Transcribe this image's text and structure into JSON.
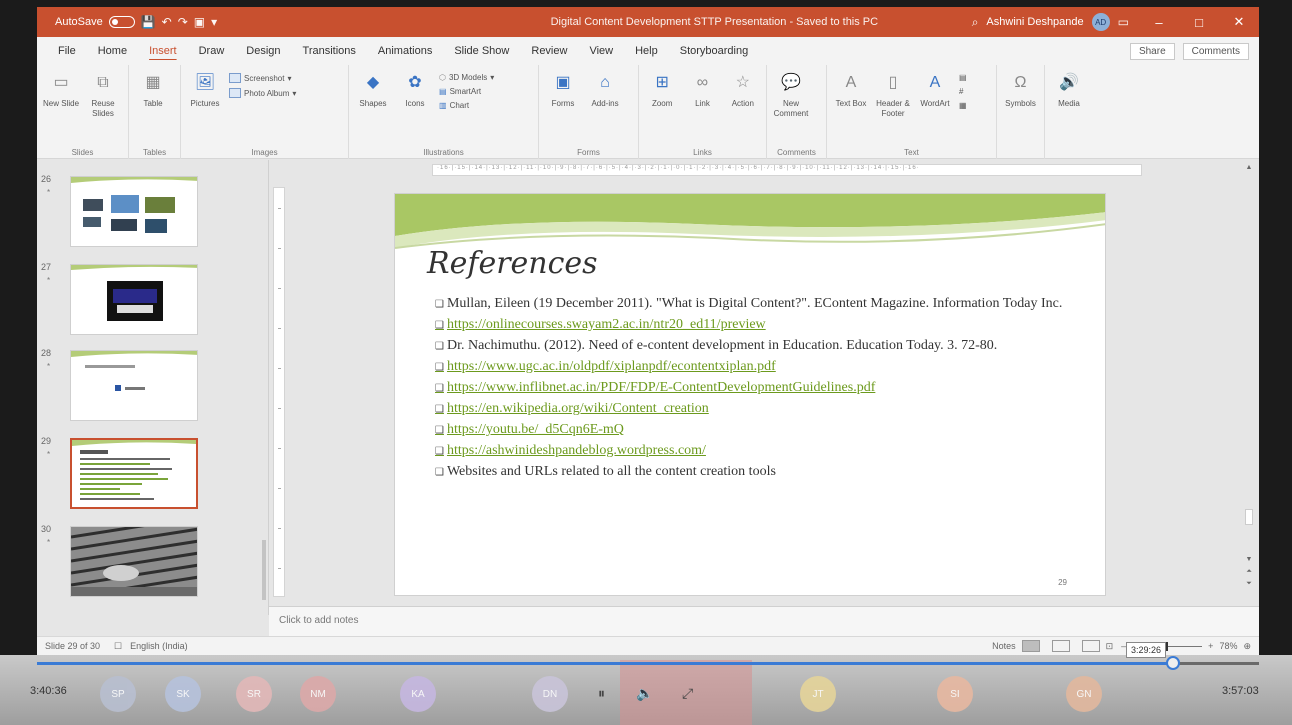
{
  "titlebar": {
    "autosave": "AutoSave",
    "autosave_state": "Off",
    "doc_title": "Digital Content Development STTP Presentation - Saved to this PC",
    "user_name": "Ashwini Deshpande",
    "user_initials": "AD",
    "minimize": "–",
    "maximize": "□",
    "close": "✕"
  },
  "tabs": [
    "File",
    "Home",
    "Insert",
    "Draw",
    "Design",
    "Transitions",
    "Animations",
    "Slide Show",
    "Review",
    "View",
    "Help",
    "Storyboarding"
  ],
  "active_tab": "Insert",
  "share_label": "Share",
  "comments_label": "Comments",
  "ribbon": {
    "slides": {
      "label": "Slides",
      "new_slide": "New Slide",
      "reuse": "Reuse Slides"
    },
    "tables": {
      "label": "Tables",
      "table": "Table"
    },
    "images": {
      "label": "Images",
      "pictures": "Pictures",
      "screenshot": "Screenshot",
      "photo_album": "Photo Album"
    },
    "illustrations": {
      "label": "Illustrations",
      "shapes": "Shapes",
      "icons": "Icons",
      "models": "3D Models",
      "smartart": "SmartArt",
      "chart": "Chart"
    },
    "forms": {
      "label": "Forms",
      "forms": "Forms"
    },
    "addins": {
      "addins": "Add-ins"
    },
    "links": {
      "label": "Links",
      "zoom": "Zoom",
      "link": "Link",
      "action": "Action"
    },
    "comments": {
      "label": "Comments",
      "new_comment": "New Comment"
    },
    "text": {
      "label": "Text",
      "textbox": "Text Box",
      "header_footer": "Header & Footer",
      "wordart": "WordArt"
    },
    "symbols": {
      "symbols": "Symbols"
    },
    "media": {
      "media": "Media"
    }
  },
  "ruler_text": "·16·|·15·|·14·|·13·|·12·|·11·|·10·|·9·|·8·|·7·|·6·|·5·|·4·|·3·|·2·|·1·|·0·|·1·|·2·|·3·|·4·|·5·|·6·|·7·|·8·|·9·|·10·|·11·|·12·|·13·|·14·|·15·|·16·",
  "thumbnails": [
    {
      "num": "26",
      "star": "*",
      "selected": false
    },
    {
      "num": "27",
      "star": "*",
      "selected": false
    },
    {
      "num": "28",
      "star": "*",
      "selected": false
    },
    {
      "num": "29",
      "star": "*",
      "selected": true
    },
    {
      "num": "30",
      "star": "*",
      "selected": false
    }
  ],
  "slide": {
    "heading": "References",
    "items": [
      {
        "text": "Mullan, Eileen (19 December 2011). \"What is Digital Content?\". EContent Magazine. Information Today Inc.",
        "link": false
      },
      {
        "text": "https://onlinecourses.swayam2.ac.in/ntr20_ed11/preview",
        "link": true
      },
      {
        "text": "Dr. Nachimuthu. (2012). Need of e-content development in Education. Education Today. 3. 72-80.",
        "link": false
      },
      {
        "text": "https://www.ugc.ac.in/oldpdf/xiplanpdf/econtentxiplan.pdf",
        "link": true
      },
      {
        "text": "https://www.inflibnet.ac.in/PDF/FDP/E-ContentDevelopmentGuidelines.pdf",
        "link": true
      },
      {
        "text": "https://en.wikipedia.org/wiki/Content_creation",
        "link": true
      },
      {
        "text": "https://youtu.be/_d5Cqn6E-mQ",
        "link": true
      },
      {
        "text": "https://ashwinideshpandeblog.wordpress.com/",
        "link": true
      },
      {
        "text": "Websites and URLs related to all the content creation tools",
        "link": false
      }
    ],
    "page_number": "29"
  },
  "notes_placeholder": "Click to add notes",
  "status": {
    "slide_of": "Slide 29 of 30",
    "language": "English (India)",
    "notes_btn": "Notes",
    "zoom": "78%"
  },
  "video": {
    "elapsed": "3:40:36",
    "hover_time": "3:29:26",
    "total": "3:57:03",
    "progress_fraction": 0.93,
    "participants": [
      {
        "initials": "SP",
        "color": "#b8bfd0"
      },
      {
        "initials": "SK",
        "color": "#b6c2dc"
      },
      {
        "initials": "SR",
        "color": "#e2b8b8"
      },
      {
        "initials": "NM",
        "color": "#dca9a9"
      },
      {
        "initials": "KA",
        "color": "#c5b7e0"
      },
      {
        "initials": "DN",
        "color": "#c9c4d9"
      },
      {
        "initials": "JT",
        "color": "#e5d49a"
      },
      {
        "initials": "SI",
        "color": "#e7b8a1"
      },
      {
        "initials": "GN",
        "color": "#e2b89e"
      }
    ],
    "pause_icon": "⏸",
    "volume_icon": "🔈",
    "fullscreen_icon": "⤢"
  }
}
